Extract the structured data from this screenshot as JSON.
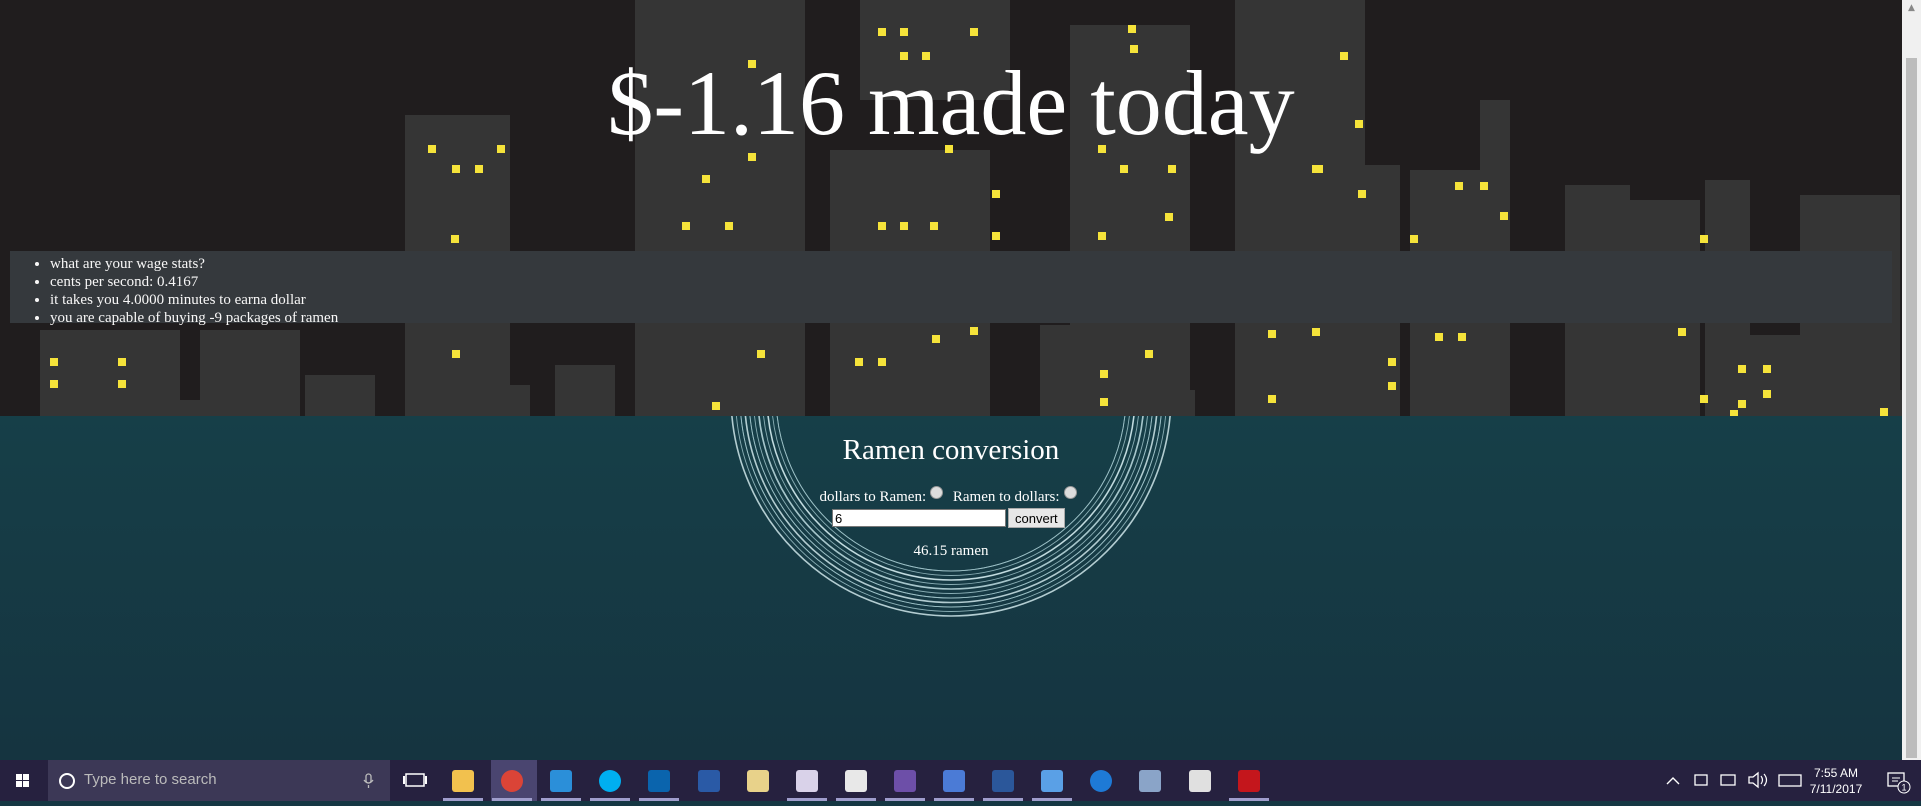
{
  "hero": {
    "title": "$-1.16 made today"
  },
  "stats": {
    "items": [
      "what are your wage stats?",
      "cents per second: 0.4167",
      "it takes you 4.0000 minutes to earna dollar",
      "you are capable of buying -9 packages of ramen"
    ]
  },
  "converter": {
    "title": "Ramen conversion",
    "mode_dollars_to_ramen": "dollars to Ramen:",
    "mode_ramen_to_dollars": "Ramen to dollars:",
    "amount_value": "6",
    "convert_label": "convert",
    "result": "46.15 ramen"
  },
  "taskbar": {
    "search_placeholder": "Type here to search",
    "time": "7:55 AM",
    "date": "7/11/2017",
    "notification_count": "1",
    "apps": [
      "file-explorer-icon",
      "chrome-icon",
      "internet-explorer-icon",
      "skype-icon",
      "outlook-icon",
      "powershell-icon",
      "eraser-icon",
      "paint-icon",
      "visual-studio-code-icon",
      "visual-studio-icon",
      "remote-desktop-icon",
      "word-icon",
      "photos-icon",
      "edge-icon",
      "tools-icon",
      "calculator-icon",
      "acrobat-icon"
    ]
  },
  "colors": {
    "sky": "#201d1e",
    "building": "#333333",
    "window": "#f5e33a",
    "lower_bg": "#153743",
    "taskbar": "#26213f"
  }
}
